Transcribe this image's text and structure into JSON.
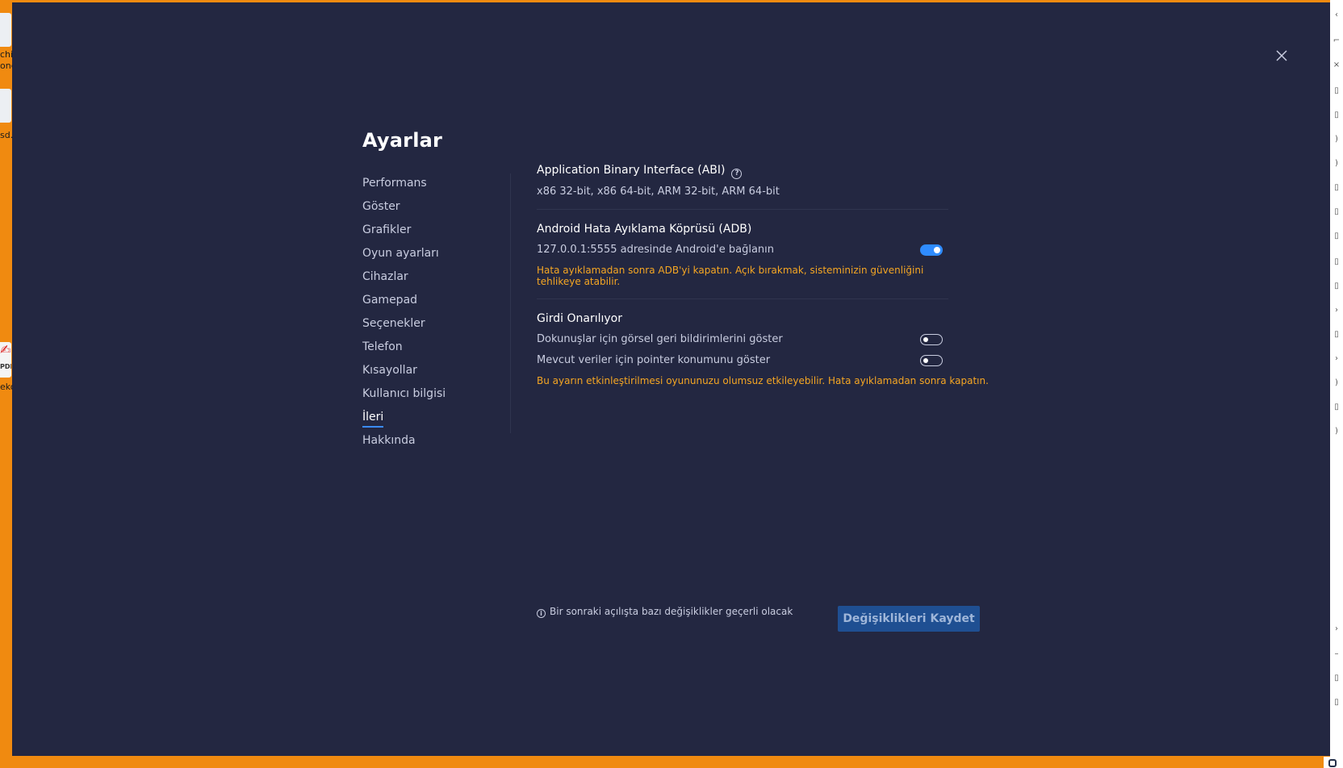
{
  "desktop": {
    "labels": [
      "chit",
      "one",
      "sd.t",
      "PDF",
      "eko"
    ]
  },
  "dialog": {
    "title": "Ayarlar",
    "close_icon": "close-icon"
  },
  "sidebar": {
    "items": [
      {
        "label": "Performans"
      },
      {
        "label": "Göster"
      },
      {
        "label": "Grafikler"
      },
      {
        "label": "Oyun ayarları"
      },
      {
        "label": "Cihazlar"
      },
      {
        "label": "Gamepad"
      },
      {
        "label": "Seçenekler"
      },
      {
        "label": "Telefon"
      },
      {
        "label": "Kısayollar"
      },
      {
        "label": "Kullanıcı bilgisi"
      },
      {
        "label": "İleri"
      },
      {
        "label": "Hakkında"
      }
    ],
    "active": "İleri"
  },
  "abi": {
    "title": "Application Binary Interface (ABI)",
    "help_icon": "question-mark",
    "value": "x86 32-bit, x86 64-bit, ARM 32-bit, ARM 64-bit"
  },
  "adb": {
    "title": "Android Hata Ayıklama Köprüsü (ADB)",
    "toggle_label": "127.0.0.1:5555 adresinde Android'e bağlanın",
    "toggle_on": true,
    "warning": "Hata ayıklamadan sonra ADB'yi kapatın. Açık bırakmak, sisteminizin güvenliğini tehlikeye atabilir."
  },
  "input": {
    "title": "Girdi Onarılıyor",
    "option1_label": "Dokunuşlar için görsel geri bildirimlerini göster",
    "option1_on": false,
    "option2_label": "Mevcut veriler için pointer konumunu göster",
    "option2_on": false,
    "warning": "Bu ayarın etkinleştirilmesi oyununuzu olumsuz etkileyebilir. Hata ayıklamadan sonra kapatın."
  },
  "footer": {
    "note": "Bir sonraki açılışta bazı değişiklikler geçerli olacak",
    "save_label": "Değişiklikleri Kaydet"
  },
  "colors": {
    "background": "#232741",
    "accent": "#2f8cff",
    "warning": "#f5a623",
    "desktop": "#f08a10"
  }
}
